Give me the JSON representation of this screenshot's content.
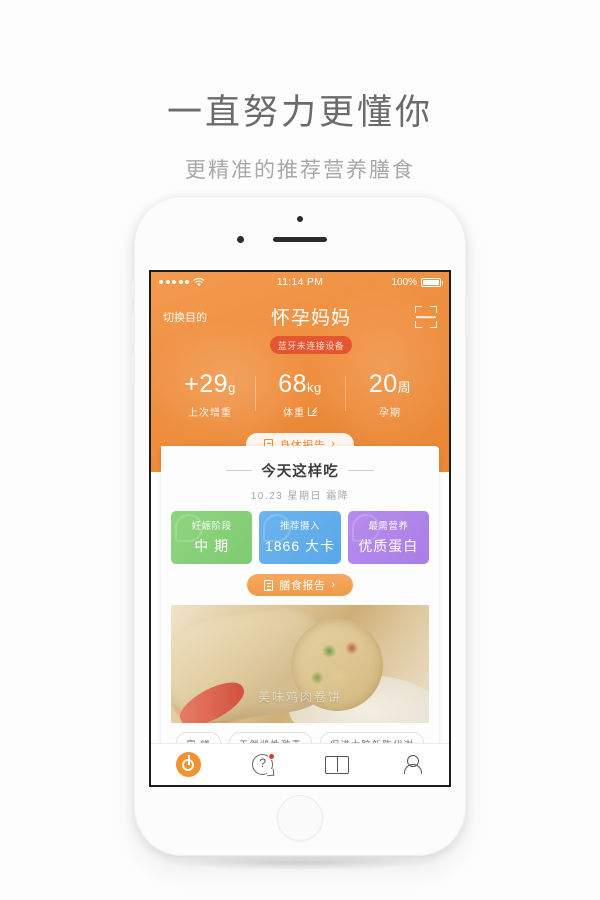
{
  "promo": {
    "title": "一直努力更懂你",
    "subtitle": "更精准的推荐营养膳食"
  },
  "status_bar": {
    "time": "11:14 PM",
    "battery": "100%",
    "signal_dots": 5,
    "wifi_icon": "wifi-icon"
  },
  "header": {
    "switch_purpose": "切换目的",
    "title": "怀孕妈妈",
    "bluetooth_badge": "蓝牙未连接设备",
    "scan_icon": "scan-icon"
  },
  "stats": [
    {
      "value": "+29",
      "unit": "g",
      "label": "上次增重",
      "has_edit_icon": false
    },
    {
      "value": "68",
      "unit": "kg",
      "label": "体重",
      "has_edit_icon": true
    },
    {
      "value": "20",
      "unit": "周",
      "label": "孕期",
      "has_edit_icon": false
    }
  ],
  "body_report_button": {
    "label": "身体报告",
    "icon": "document-icon",
    "chevron": "›"
  },
  "card": {
    "title": "今天这样吃",
    "date": "10.23  星期日  霜降",
    "tiles": [
      {
        "caption": "妊娠阶段",
        "value": "中 期",
        "color": "#8fd57f"
      },
      {
        "caption": "推荐摄入",
        "value": "1866 大卡",
        "color": "#6bb4ee"
      },
      {
        "caption": "最需营养",
        "value": "优质蛋白",
        "color": "#b68cec"
      }
    ],
    "meal_report_button": {
      "label": "膳食报告",
      "icon": "document-icon",
      "chevron": "›"
    },
    "food_photo_overlay": "美味鸡肉卷饼",
    "tags": [
      "富 镁",
      "天然雌性激素",
      "促进大脑新陈代谢"
    ]
  },
  "tabbar": [
    {
      "name": "home",
      "icon": "pie-chart-icon",
      "active": true,
      "badge": false
    },
    {
      "name": "ask",
      "icon": "question-chat-icon",
      "active": false,
      "badge": true
    },
    {
      "name": "library",
      "icon": "book-icon",
      "active": false,
      "badge": false
    },
    {
      "name": "profile",
      "icon": "person-icon",
      "active": false,
      "badge": false
    }
  ],
  "colors": {
    "brand_orange": "#ef8f3f",
    "badge_red": "#e4562f",
    "tile_green": "#8fd57f",
    "tile_blue": "#6bb4ee",
    "tile_purple": "#b68cec"
  }
}
